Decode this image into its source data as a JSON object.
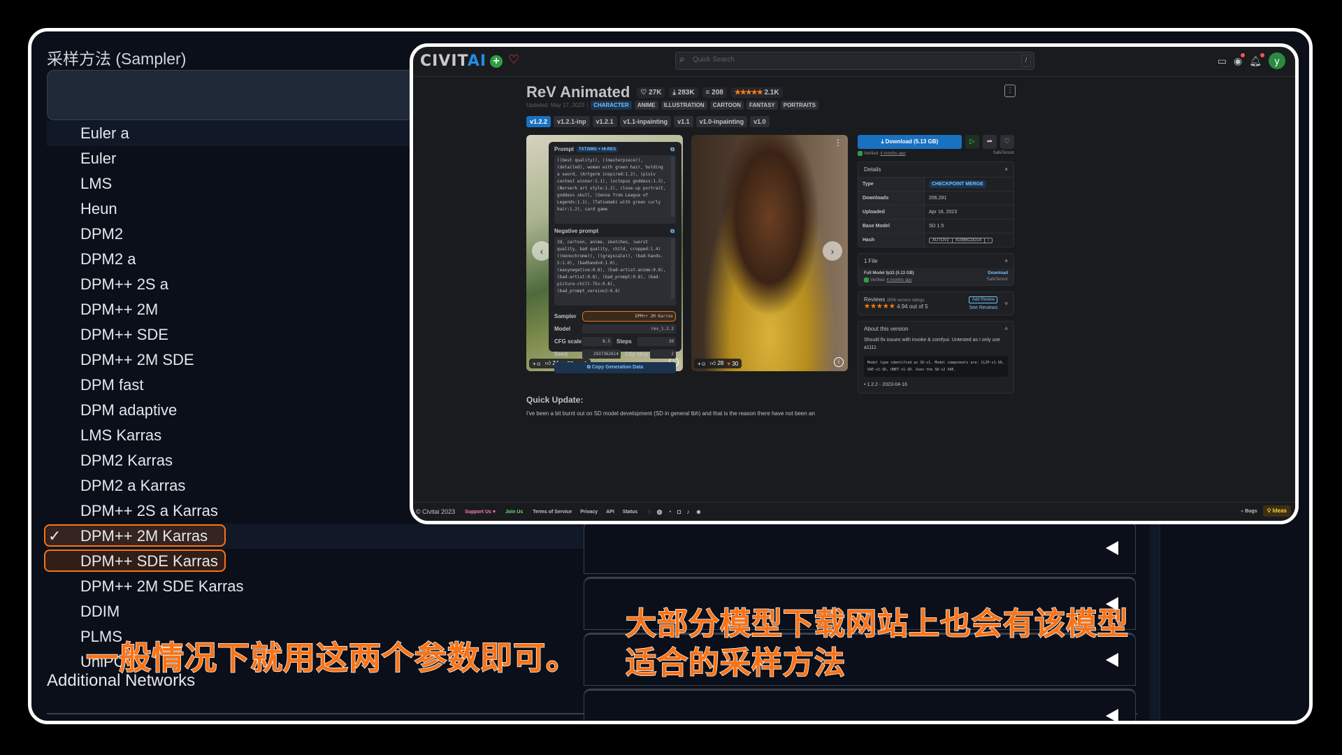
{
  "sampler_panel": {
    "label": "采样方法 (Sampler)",
    "items": [
      "Euler a",
      "Euler",
      "LMS",
      "Heun",
      "DPM2",
      "DPM2 a",
      "DPM++ 2S a",
      "DPM++ 2M",
      "DPM++ SDE",
      "DPM++ 2M SDE",
      "DPM fast",
      "DPM adaptive",
      "LMS Karras",
      "DPM2 Karras",
      "DPM2 a Karras",
      "DPM++ 2S a Karras",
      "DPM++ 2M Karras",
      "DPM++ SDE Karras",
      "DPM++ 2M SDE Karras",
      "DDIM",
      "PLMS",
      "UniPC"
    ],
    "selected": "DPM++ 2M Karras",
    "check_glyph": "✓",
    "additional_networks": "Additional Networks",
    "accordion_icon": "triangle-left-icon"
  },
  "captions": {
    "left": "一般情况下就用这两个参数即可。",
    "right": "大部分模型下载网站上也会有该模型适合的采样方法",
    "color": "#f97316"
  },
  "civitai": {
    "logo_part1": "CIVIT",
    "logo_part2": "AI",
    "search_placeholder": "Quick Search",
    "search_shortcut": "/",
    "avatar_letter": "y",
    "model_title": "ReV Animated",
    "stats": {
      "likes": "27K",
      "downloads": "283K",
      "collections": "208",
      "rating_count": "2.1K",
      "stars": "★★★★★"
    },
    "updated": "Updated: May 17, 2023",
    "tags": [
      "CHARACTER",
      "ANIME",
      "ILLUSTRATION",
      "CARTOON",
      "FANTASY",
      "PORTRAITS"
    ],
    "versions": [
      "v1.2.2",
      "v1.2.1-inp",
      "v1.2.1",
      "v1.1-inpainting",
      "v1.1",
      "v1.0-inpainting",
      "v1.0"
    ],
    "active_version": "v1.2.2",
    "gen_panel": {
      "prompt_label": "Prompt",
      "prompt_badge": "TXT2IMG + HI-RES",
      "prompt": "((best quality)), ((masterpiece)), (detailed), woman with green hair, holding a sword, (Artgerm inspired:1.2), (pixiv contest winner:1.1), (octopus goddess:1.3), (Berserk art style:1.2), close-up portrait, goddess skull, (Senna from League of Legends:1.1), (Tatsumaki with green curly hair:1.2), card game",
      "negative_label": "Negative prompt",
      "negative": "3d, cartoon, anime, sketches, (worst quality, bad quality, child, cropped:1.4) ((monochrome)), ((grayscale)), (bad-hands-5:1.0), (badhandv4:1.0), (easynegative:0.8), (bad-artist-anime:0.8), (bad-artist:0.8), (bad_prompt:0.8), (bad-picture-chill-75v:0.8), (bad_prompt_version2:0.8)",
      "sampler_label": "Sampler",
      "sampler": "DPM++ 2M Karras",
      "model_label": "Model",
      "model": "rev_1.2.2",
      "cfg_label": "CFG scale",
      "cfg": "8.5",
      "steps_label": "Steps",
      "steps": "30",
      "seed_label": "Seed",
      "seed": "2937362614",
      "clip_label": "Clip skip",
      "clip": "2",
      "copy_button": "Copy Generation Data"
    },
    "image1_reactions": {
      "likes": "24",
      "hearts": "57",
      "laugh": "1"
    },
    "image2_reactions": {
      "likes": "28",
      "hearts": "30"
    },
    "download_button": "Download (5.13 GB)",
    "verified_text": "Verified:",
    "verified_when": "4 months ago",
    "safetensor": "SafeTensor",
    "details": {
      "title": "Details",
      "rows": [
        {
          "key": "Type",
          "value": "CHECKPOINT MERGE"
        },
        {
          "key": "Downloads",
          "value": "206,281"
        },
        {
          "key": "Uploaded",
          "value": "Apr 16, 2023"
        },
        {
          "key": "Base Model",
          "value": "SD 1.5"
        }
      ],
      "hash_label": "Hash",
      "hash_type": "AUTOV2",
      "hash_value": "4199BCDD14"
    },
    "files": {
      "title": "1 File",
      "name": "Full Model fp32 (5.13 GB)",
      "download": "Download"
    },
    "reviews": {
      "title": "Reviews",
      "count": "1506 version ratings",
      "stars": "★★★★★",
      "score": "4.94 out of 5",
      "add": "Add Review",
      "see": "See Reviews"
    },
    "about": {
      "title": "About this version",
      "text": "Should fix issues with invoke & comfyui. Untested as I only use a1111",
      "code": "Model type identified as SD-v1. Model components are: CLIP-v1-SD, VAE-v1-SD, UNET-v1-SD. Uses the SD-v2 VAE.",
      "bullet": "1.2.2 - 2023-04-16"
    },
    "quick_update_title": "Quick Update:",
    "quick_update_text": "I've been a bit burnt out on SD model development (SD in general tbh) and that is the reason there have not been an",
    "footer": {
      "copyright": "© Civitai 2023",
      "support": "Support Us ♥",
      "join": "Join Us",
      "links": [
        "Terms of Service",
        "Privacy",
        "API",
        "Status"
      ],
      "bugs": "Bugs",
      "ideas": "Ideas"
    }
  }
}
